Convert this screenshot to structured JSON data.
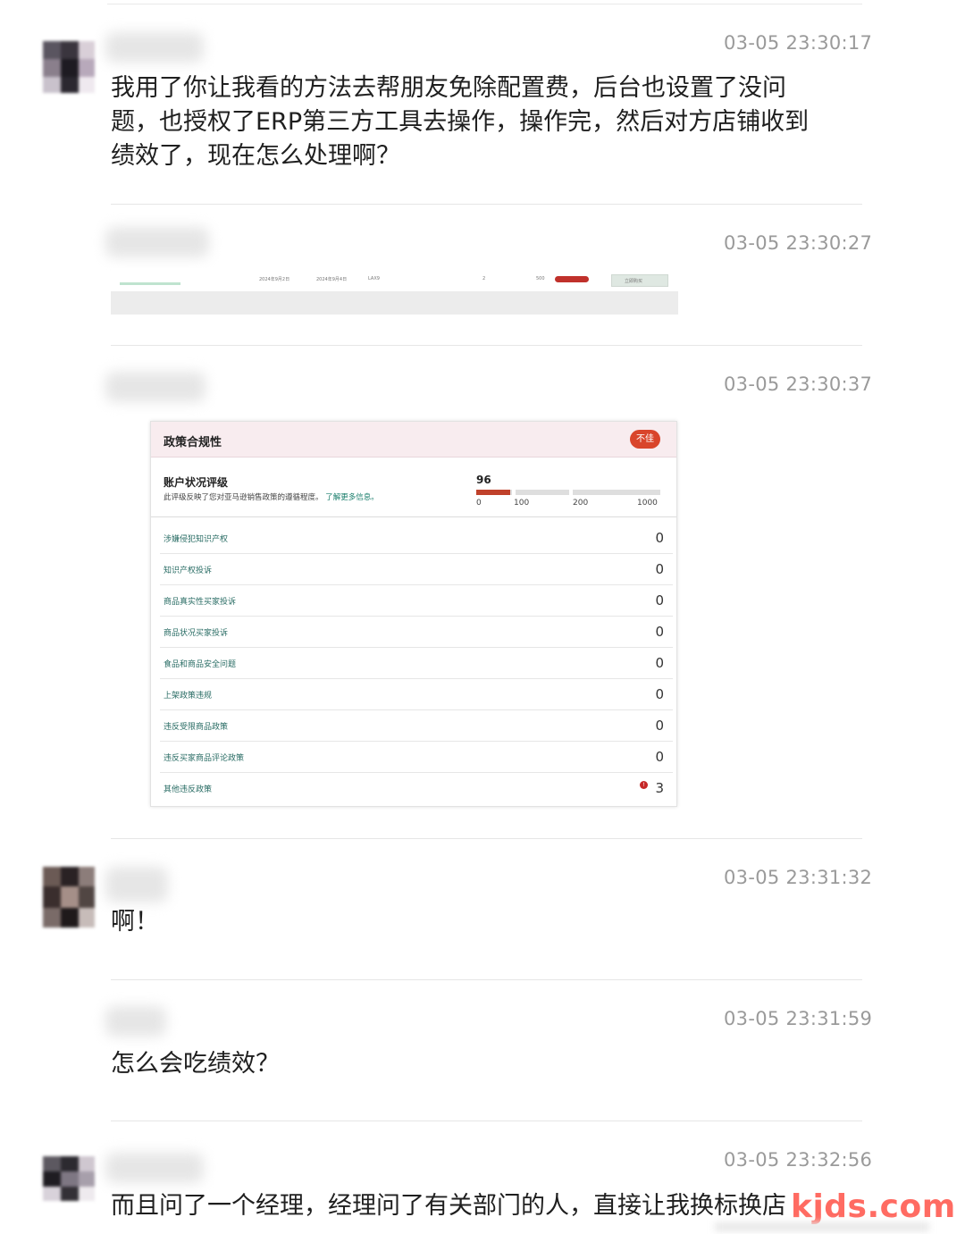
{
  "messages": [
    {
      "timestamp": "03-05 23:30:17",
      "text": "我用了你让我看的方法去帮朋友免除配置费，后台也设置了没问题，也授权了ERP第三方工具去操作，操作完，然后对方店铺收到绩效了，现在怎么处理啊？"
    },
    {
      "timestamp": "03-05 23:30:27",
      "thin_table": {
        "cells": [
          "2024年9月2日",
          "2024年9月4日",
          "LAX9",
          "2",
          "500",
          "立即购买"
        ]
      }
    },
    {
      "timestamp": "03-05 23:30:37",
      "policy_panel": {
        "title": "政策合规性",
        "badge": "不佳",
        "health_title": "账户状况评级",
        "health_desc": "此评级反映了您对亚马逊销售政策的遵循程度。",
        "health_link": "了解更多信息。",
        "score": "96",
        "score_value": 96,
        "scale_labels": [
          "0",
          "100",
          "200",
          "1000"
        ],
        "rows": [
          {
            "label": "涉嫌侵犯知识产权",
            "value": "0"
          },
          {
            "label": "知识产权投诉",
            "value": "0"
          },
          {
            "label": "商品真实性买家投诉",
            "value": "0"
          },
          {
            "label": "商品状况买家投诉",
            "value": "0"
          },
          {
            "label": "食品和商品安全问题",
            "value": "0"
          },
          {
            "label": "上架政策违规",
            "value": "0"
          },
          {
            "label": "违反受限商品政策",
            "value": "0"
          },
          {
            "label": "违反买家商品评论政策",
            "value": "0"
          },
          {
            "label": "其他违反政策",
            "value": "3",
            "warn": "!"
          }
        ]
      }
    },
    {
      "timestamp": "03-05 23:31:32",
      "text": "啊！"
    },
    {
      "timestamp": "03-05 23:31:59",
      "text": "怎么会吃绩效？"
    },
    {
      "timestamp": "03-05 23:32:56",
      "text": "而且问了一个经理，经理问了有关部门的人，直接让我换标换店"
    }
  ],
  "watermark": "kjds.com",
  "colors": {
    "badge": "#d9452b",
    "link": "#177c6a",
    "timestamp": "#9a9a9a",
    "watermark": "#ff6b62"
  }
}
